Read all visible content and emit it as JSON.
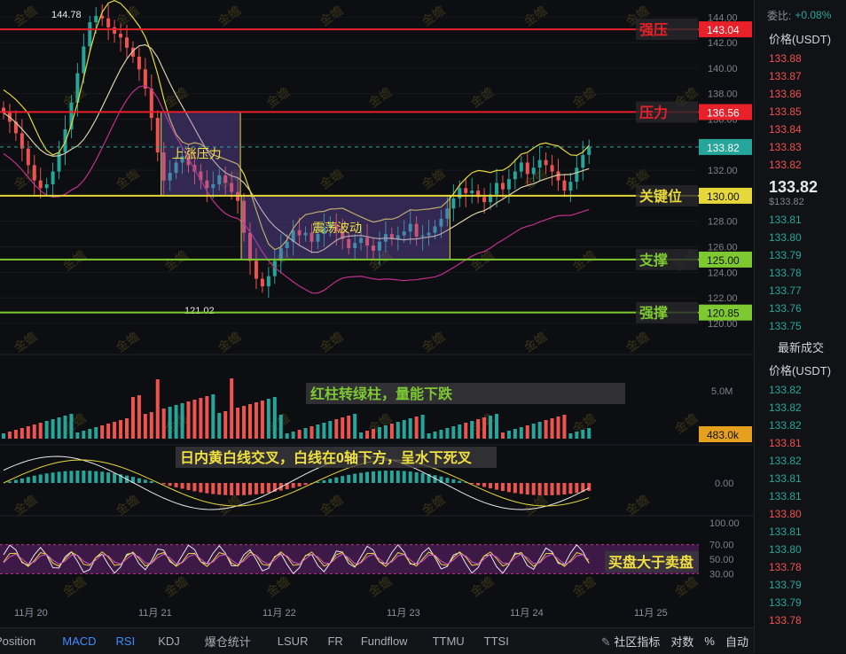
{
  "watermark": "金蟾",
  "chart_data": {
    "type": "candlestick",
    "x_tick_labels": [
      "11月 20",
      "11月 21",
      "11月 22",
      "11月 23",
      "11月 24",
      "11月 25"
    ],
    "price_axis": {
      "ticks": [
        "144.00",
        "142.00",
        "140.00",
        "138.00",
        "136.00",
        "134.00",
        "132.00",
        "130.00",
        "128.00",
        "126.00",
        "124.00",
        "122.00",
        "120.00"
      ],
      "range": [
        119.3,
        145.2
      ]
    },
    "price_series_close": [
      136.5,
      135.8,
      134.9,
      133.7,
      132.4,
      131.2,
      130.6,
      130.9,
      131.9,
      133.4,
      135.2,
      137.3,
      139.6,
      141.7,
      143.6,
      144.1,
      143.9,
      143.2,
      142.7,
      142.4,
      141.6,
      140.9,
      139.9,
      138.4,
      136.1,
      133.4,
      131.2,
      131.8,
      132.6,
      133.1,
      132.4,
      131.9,
      131.2,
      130.6,
      130.9,
      131.6,
      131.0,
      130.3,
      129.6,
      127.1,
      124.9,
      123.5,
      122.9,
      123.7,
      124.9,
      125.9,
      126.4,
      127.3,
      126.9,
      127.1,
      126.4,
      127.0,
      127.5,
      127.8,
      127.2,
      126.6,
      125.9,
      126.3,
      126.7,
      126.1,
      125.7,
      126.4,
      127.0,
      126.6,
      126.9,
      127.2,
      127.8,
      126.8,
      126.9,
      127.1,
      127.6,
      128.2,
      129.0,
      129.8,
      130.6,
      130.2,
      130.4,
      129.9,
      129.5,
      130.1,
      131.0,
      130.5,
      131.3,
      131.9,
      132.6,
      131.7,
      132.2,
      132.8,
      132.4,
      131.9,
      131.2,
      130.4,
      131.1,
      132.2,
      133.2,
      133.8
    ],
    "price_high": 144.78,
    "price_low": 121.02,
    "horizontal_levels": [
      {
        "label": "强压",
        "value": 143.04,
        "tag": "143.04",
        "color": "#e8202a"
      },
      {
        "label": "压力",
        "value": 136.56,
        "tag": "136.56",
        "color": "#e8202a"
      },
      {
        "label": "关键位",
        "value": 130.0,
        "tag": "130.00",
        "color": "#e6d83b"
      },
      {
        "label": "支撑",
        "value": 125.0,
        "tag": "125.00",
        "color": "#7ec832"
      },
      {
        "label": "强撑",
        "value": 120.85,
        "tag": "120.85",
        "color": "#7ec832"
      }
    ],
    "current_price": {
      "value": 133.82,
      "tag": "133.82",
      "color": "#26a69a"
    },
    "zones": [
      {
        "label": "上涨压力",
        "from_index": 26,
        "to_index": 38,
        "top": 136.56,
        "bottom": 130.0
      },
      {
        "label": "震荡波动",
        "from_index": 39,
        "to_index": 72,
        "top": 130.0,
        "bottom": 125.0
      }
    ],
    "volume": {
      "axis_ticks": [
        "5.0M"
      ],
      "current_tag": "483.0k",
      "annotation": "红柱转绿柱，量能下跌"
    },
    "macd": {
      "axis_ticks": [
        "0.00"
      ],
      "annotation": "日内黄白线交叉，白线在0轴下方，呈水下死叉"
    },
    "rsi": {
      "axis_ticks": [
        "100.00",
        "70.00",
        "50.00",
        "30.00"
      ],
      "annotation": "买盘大于卖盘"
    }
  },
  "toolbar": {
    "tabs": [
      "Position",
      "MACD",
      "RSI",
      "KDJ",
      "爆仓统计",
      "LSUR",
      "FR",
      "Fundflow",
      "TTMU",
      "TTSI"
    ],
    "active": [
      "MACD",
      "RSI"
    ],
    "right": {
      "community": "社区指标",
      "log": "对数",
      "percent": "%",
      "auto": "自动"
    }
  },
  "orderbook": {
    "ratio_label": "委比:",
    "ratio_value": "+0.08%",
    "price_header": "价格(USDT)",
    "asks": [
      "133.88",
      "133.87",
      "133.86",
      "133.85",
      "133.84",
      "133.83",
      "133.82"
    ],
    "last_price": "133.82",
    "last_price_usd": "$133.82",
    "bids": [
      "133.81",
      "133.80",
      "133.79",
      "133.78",
      "133.77",
      "133.76",
      "133.75"
    ],
    "trades_title": "最新成交",
    "trades_header": "价格(USDT)",
    "trades": [
      {
        "p": "133.82",
        "s": "buy"
      },
      {
        "p": "133.82",
        "s": "buy"
      },
      {
        "p": "133.82",
        "s": "buy"
      },
      {
        "p": "133.81",
        "s": "sell"
      },
      {
        "p": "133.82",
        "s": "buy"
      },
      {
        "p": "133.81",
        "s": "buy"
      },
      {
        "p": "133.81",
        "s": "buy"
      },
      {
        "p": "133.80",
        "s": "sell"
      },
      {
        "p": "133.81",
        "s": "buy"
      },
      {
        "p": "133.80",
        "s": "buy"
      },
      {
        "p": "133.78",
        "s": "sell"
      },
      {
        "p": "133.79",
        "s": "buy"
      },
      {
        "p": "133.79",
        "s": "buy"
      },
      {
        "p": "133.78",
        "s": "sell"
      }
    ]
  }
}
